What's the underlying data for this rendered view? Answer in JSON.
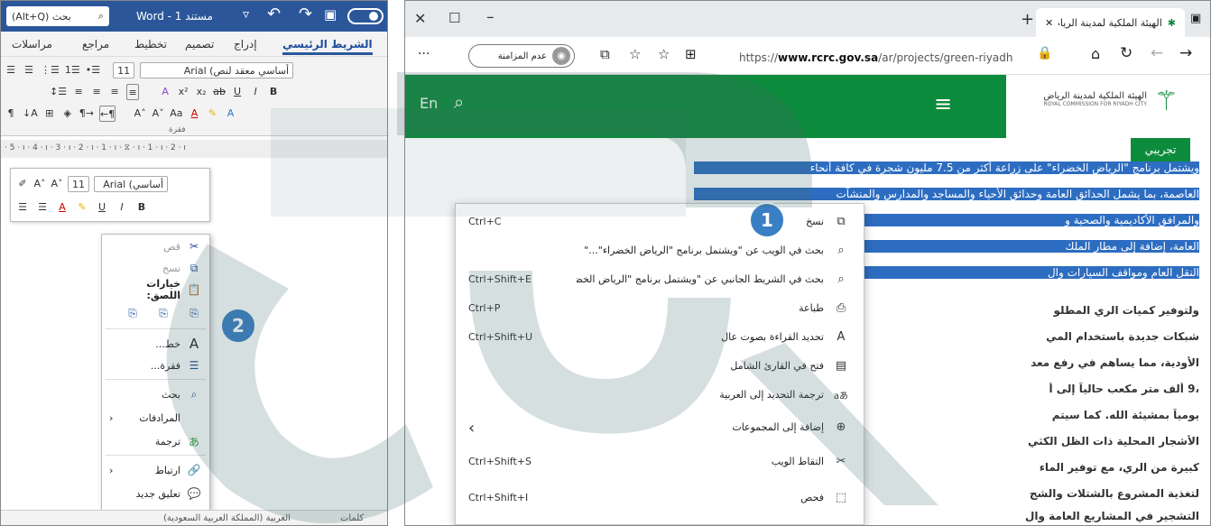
{
  "word": {
    "search": "(Alt+Q) بحث",
    "title": "Word - 1 مستند",
    "tabs": [
      "مراسلات",
      "مراجع",
      "تخطيط",
      "تصميم",
      "إدراج",
      "الشريط الرئيسي"
    ],
    "font_name": "Arial (أساسي معقد لنص",
    "font_size": "11",
    "group_paragraph": "فقرة",
    "ruler": "· 5 · ı · 4 · ı · 3 · ı · 2 · ı · 1 · ı · ⧖ · ı · 1 · ı · 2 · ı",
    "mini_font": "Arial (أساسي",
    "mini_size": "11",
    "context_menu": {
      "cut": "قص",
      "copy": "نسخ",
      "paste_options": "خيارات اللصق:",
      "font": "خط...",
      "paragraph": "فقرة...",
      "search": "بحث",
      "synonyms": "المرادفات",
      "translate": "ترجمة",
      "link": "ارتباط",
      "new_comment": "تعليق جديد"
    },
    "status": "العربية (المملكة العربية السعودية)",
    "status_words": "كلمات"
  },
  "edge": {
    "tab_title": "الهيئة الملكية لمدينة الرياض » برنا",
    "url_prefix": "https://",
    "url_domain": "www.rcrc.gov.sa",
    "url_path": "/ar/projects/green-riyadh",
    "guest_label": "عدم المزامنة",
    "site_lang": "En",
    "org_name_ar": "الهيئة الملكية لمدينة الرياض",
    "org_name_en": "ROYAL COMMISSION FOR RIYADH CITY",
    "beta_button": "تجريبي",
    "paragraph_lines": [
      "ويشتمل برنامج \"الرياض الخضراء\" على زراعة أكثر من 7.5 مليون شجرة في كافة أنحاء",
      "العاصمة، بما يشمل الحدائق العامة وحدائق الأحياء والمساجد والمدارس والمنشآت",
      "والمرافق الأكاديمية والصحية و",
      "العامة، إضافة إلى مطار الملك",
      "النقل العام ومواقف السيارات وال"
    ],
    "paragraph2_lines": [
      "ولتوفير كميات الري المطلو",
      "شبكات جديدة باستخدام المي",
      "الأودية، مما يساهم في رفع معد",
      "،9 ألف متر مكعب حالياً إلى أ",
      "يومياً بمشيئة الله. كما سيتم",
      "الأشجار المحلية ذات الظل الكثي",
      "كبيرة من الري، مع توفير الماء",
      "لتغذية المشروع بالشتلات والشج",
      "التشجير في المشاريع العامة وال"
    ],
    "context_menu": [
      {
        "label": "نسخ",
        "shortcut": "Ctrl+C",
        "icon": "copy-icon",
        "glyph": "⧉"
      },
      {
        "label": "بحث في الويب عن \"ويشتمل برنامج \"الرياض الخضراء\"...\"",
        "shortcut": "",
        "icon": "search-icon",
        "glyph": "⌕"
      },
      {
        "label": "بحث في الشريط الجانبي عن \"ويشتمل برنامج \"الرياض الخضراء\"...\"",
        "shortcut": "Ctrl+Shift+E",
        "icon": "sidebar-search-icon",
        "glyph": "⌕"
      },
      {
        "label": "طباعة",
        "shortcut": "Ctrl+P",
        "icon": "print-icon",
        "glyph": "⎙"
      },
      {
        "label": "تحديد القراءة بصوت عال",
        "shortcut": "Ctrl+Shift+U",
        "icon": "read-aloud-icon",
        "glyph": "A"
      },
      {
        "label": "فتح في القارئ الشامل",
        "shortcut": "",
        "icon": "immersive-reader-icon",
        "glyph": "▤"
      },
      {
        "label": "ترجمة التحديد إلى العربية",
        "shortcut": "",
        "icon": "translate-icon",
        "glyph": "aあ"
      },
      {
        "label": "إضافة إلى المجموعات",
        "shortcut": "",
        "icon": "collections-icon",
        "glyph": "⊕"
      },
      {
        "label": "التقاط الويب",
        "shortcut": "Ctrl+Shift+S",
        "icon": "web-capture-icon",
        "glyph": "✂"
      },
      {
        "label": "فحص",
        "shortcut": "Ctrl+Shift+I",
        "icon": "inspect-icon",
        "glyph": "⬚"
      }
    ]
  },
  "badges": {
    "one": "1",
    "two": "2"
  },
  "colors": {
    "word_blue": "#2b579a",
    "site_green": "#0d8b3c",
    "selection": "#2d6dc1",
    "badge": "#3a7fc4"
  }
}
